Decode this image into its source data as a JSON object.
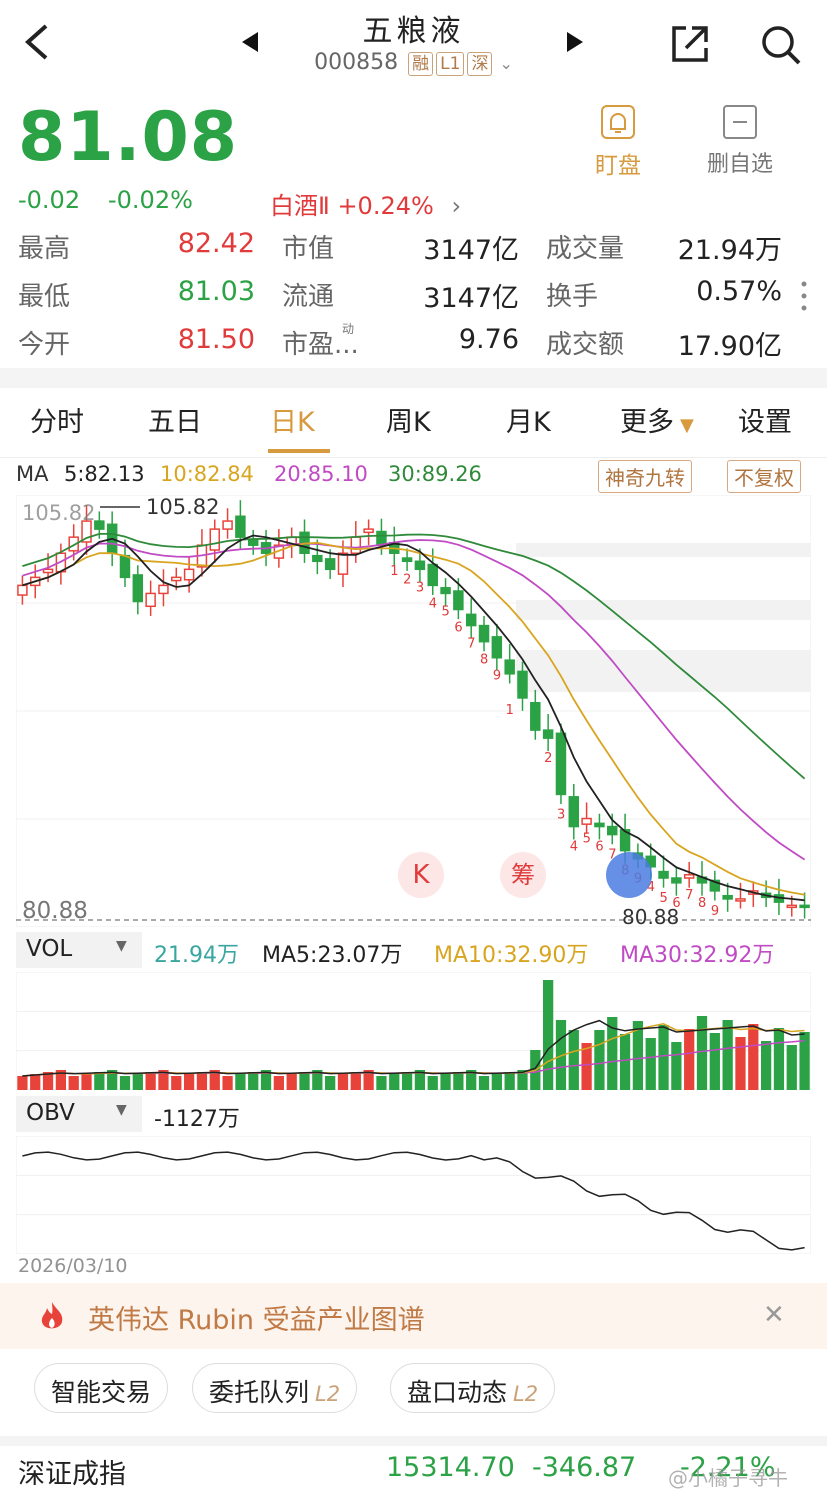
{
  "header": {
    "back_icon": "chevron-left-icon",
    "title": "五粮液",
    "code": "000858",
    "tags": [
      "融",
      "L1",
      "深"
    ],
    "share_icon": "external-link-icon",
    "search_icon": "search-icon"
  },
  "quote": {
    "price": "81.08",
    "change": "-0.02",
    "change_pct": "-0.02%",
    "sector": "白酒Ⅱ +0.24%",
    "watch_label": "盯盘",
    "remove_label": "删自选",
    "stats": [
      {
        "label": "最高",
        "value": "82.42"
      },
      {
        "label": "市值",
        "value": "3147亿"
      },
      {
        "label": "成交量",
        "value": "21.94万"
      },
      {
        "label": "最低",
        "value": "81.03"
      },
      {
        "label": "流通",
        "value": "3147亿"
      },
      {
        "label": "换手",
        "value": "0.57%"
      },
      {
        "label": "今开",
        "value": "81.50"
      },
      {
        "label": "市盈...",
        "value": "9.76"
      },
      {
        "label": "成交额",
        "value": "17.90亿"
      }
    ],
    "pe_sup": "动"
  },
  "tabs": [
    "分时",
    "五日",
    "日K",
    "周K",
    "月K",
    "更多",
    "设置"
  ],
  "ma": {
    "label": "MA",
    "ma5": "5:82.13",
    "ma10": "10:82.84",
    "ma20": "20:85.10",
    "ma30": "30:89.26",
    "chip1": "神奇九转",
    "chip2": "不复权",
    "colors": {
      "ma5": "#222222",
      "ma10": "#d9a520",
      "ma20": "#c04bc4",
      "ma30": "#2f8a3a"
    }
  },
  "chart_data": {
    "type": "candlestick",
    "high_label": "105.82",
    "low_label": "80.88",
    "bottom_label": "80.88",
    "top_axis_label": "105.82",
    "date_label": "2026/03/10",
    "icons": [
      "K",
      "筹"
    ],
    "closes": [
      101,
      101.5,
      102,
      103,
      104,
      105,
      104.5,
      103,
      101.5,
      100,
      100.5,
      101,
      101.5,
      102,
      103.5,
      104.5,
      105,
      104,
      103.5,
      103,
      103.5,
      104,
      103,
      102.5,
      102,
      103,
      104,
      104.5,
      103.5,
      103,
      102.5,
      102,
      101,
      100.5,
      99.5,
      98.5,
      97.5,
      96.5,
      95.5,
      94,
      92,
      91.5,
      88,
      86,
      86.5,
      86,
      85.5,
      84.5,
      84,
      83.5,
      82.8,
      82.5,
      83,
      82.5,
      82,
      81.5,
      81.5,
      82,
      81.6,
      81.3,
      81.1,
      81.08
    ],
    "nine_counts_a": [
      "1",
      "2",
      "3",
      "4",
      "5",
      "6",
      "7",
      "8",
      "9",
      "1"
    ],
    "nine_counts_b": [
      "2",
      "3",
      "4",
      "5",
      "6",
      "7",
      "8",
      "9",
      "4",
      "5",
      "6",
      "7",
      "8",
      "9"
    ]
  },
  "volume": {
    "label": "VOL",
    "value": "21.94万",
    "ma5": "MA5:23.07万",
    "ma10": "MA10:32.90万",
    "ma30": "MA30:32.92万"
  },
  "obv": {
    "label": "OBV",
    "value": "-1127万"
  },
  "banner": {
    "text": "英伟达 Rubin 受益产业图谱",
    "fire_icon": "fire-icon",
    "close_icon": "close-icon"
  },
  "actions": [
    {
      "label": "智能交易",
      "l2": ""
    },
    {
      "label": "委托队列",
      "l2": "L2"
    },
    {
      "label": "盘口动态",
      "l2": "L2"
    }
  ],
  "footer": {
    "index_name": "深证成指",
    "index_value": "15314.70",
    "index_change": "-346.87",
    "index_pct": "-2.21%",
    "watermark": "@小橘子寻牛"
  }
}
